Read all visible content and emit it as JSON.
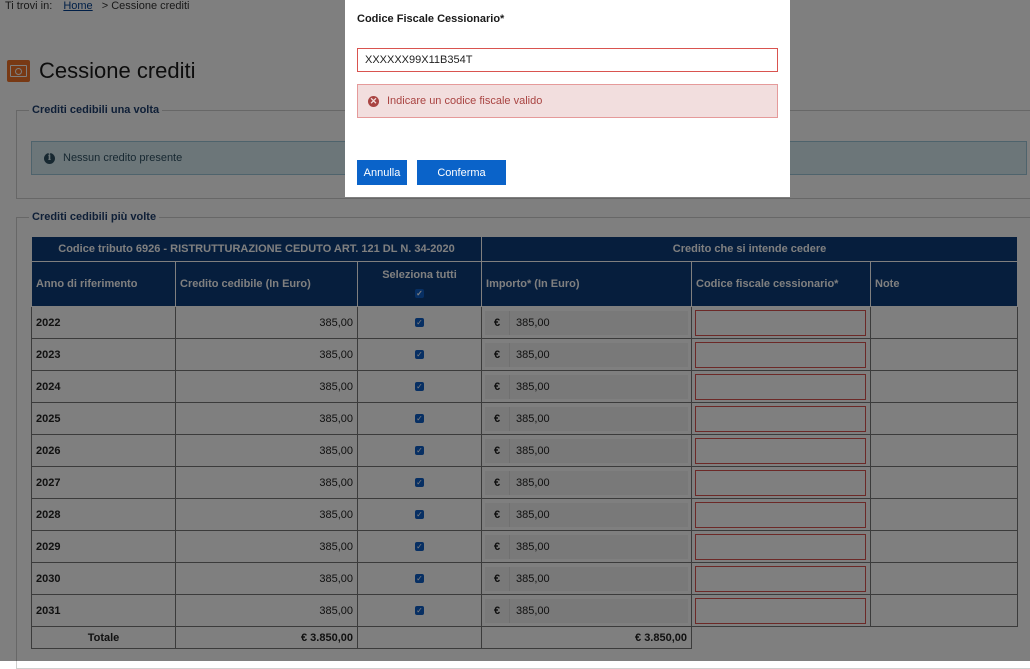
{
  "breadcrumb": {
    "prefix": "Ti trovi in:",
    "home": "Home",
    "separator": ">",
    "current": "Cessione crediti"
  },
  "page": {
    "title": "Cessione crediti",
    "title_icon": "banknote-icon"
  },
  "section_once": {
    "legend": "Crediti cedibili una volta",
    "info_text": "Nessun credito presente"
  },
  "section_multi": {
    "legend": "Crediti cedibili più volte",
    "group_left": "Codice tributo 6926 - RISTRUTTURAZIONE CEDUTO ART. 121 DL N. 34-2020",
    "group_right": "Credito che si intende cedere",
    "col_year": "Anno di riferimento",
    "col_credit": "Credito cedibile (In Euro)",
    "col_select": "Seleziona tutti",
    "col_amount": "Importo* (In Euro)",
    "col_cf": "Codice fiscale cessionario*",
    "col_note": "Note",
    "currency_symbol": "€",
    "rows": [
      {
        "year": "2022",
        "credit": "385,00",
        "amount": "385,00",
        "checked": true
      },
      {
        "year": "2023",
        "credit": "385,00",
        "amount": "385,00",
        "checked": true
      },
      {
        "year": "2024",
        "credit": "385,00",
        "amount": "385,00",
        "checked": true
      },
      {
        "year": "2025",
        "credit": "385,00",
        "amount": "385,00",
        "checked": true
      },
      {
        "year": "2026",
        "credit": "385,00",
        "amount": "385,00",
        "checked": true
      },
      {
        "year": "2027",
        "credit": "385,00",
        "amount": "385,00",
        "checked": true
      },
      {
        "year": "2028",
        "credit": "385,00",
        "amount": "385,00",
        "checked": true
      },
      {
        "year": "2029",
        "credit": "385,00",
        "amount": "385,00",
        "checked": true
      },
      {
        "year": "2030",
        "credit": "385,00",
        "amount": "385,00",
        "checked": true
      },
      {
        "year": "2031",
        "credit": "385,00",
        "amount": "385,00",
        "checked": true
      }
    ],
    "total_label": "Totale",
    "total_credit": "€ 3.850,00",
    "total_amount": "€ 3.850,00"
  },
  "modal": {
    "label": "Codice Fiscale Cessionario*",
    "input_value": "XXXXXX99X11B354T",
    "error_text": "Indicare un codice fiscale valido",
    "cancel_label": "Annulla",
    "confirm_label": "Conferma"
  },
  "colors": {
    "header_bg": "#0d3c7a",
    "button_bg": "#0a63c9",
    "accent_orange": "#f07328",
    "error_border": "#d9534f",
    "error_bg": "#f2dede",
    "info_bg": "#d9ecf3"
  }
}
